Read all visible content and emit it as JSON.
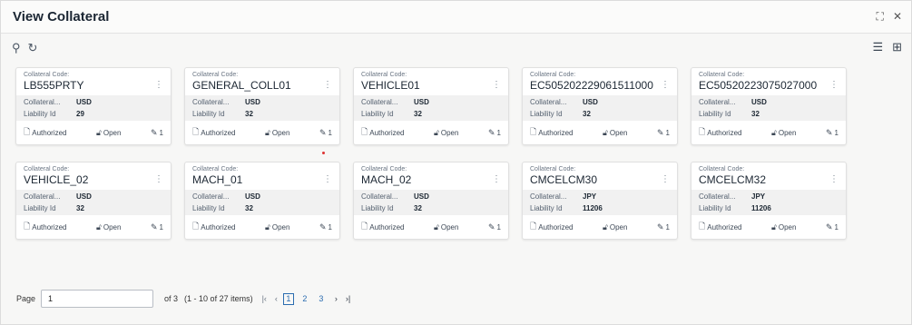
{
  "window": {
    "title": "View Collateral",
    "expand_icon": "⛶",
    "close_icon": "✕"
  },
  "toolbar": {
    "search_icon": "⚲",
    "refresh_icon": "↻",
    "list_view_icon": "☰",
    "grid_view_icon": "⊞"
  },
  "labels": {
    "code_label": "Collateral Code:",
    "collateral_label": "Collateral...",
    "liability_label": "Liability Id",
    "authorized": "Authorized",
    "open": "Open",
    "kebab": "⋮"
  },
  "cards": [
    {
      "code": "LB555PRTY",
      "currency": "USD",
      "liability_id": "29",
      "count": "1"
    },
    {
      "code": "GENERAL_COLL01",
      "currency": "USD",
      "liability_id": "32",
      "count": "1"
    },
    {
      "code": "VEHICLE01",
      "currency": "USD",
      "liability_id": "32",
      "count": "1"
    },
    {
      "code": "EC505202229061511000",
      "currency": "USD",
      "liability_id": "32",
      "count": "1"
    },
    {
      "code": "EC50520223075027000",
      "currency": "USD",
      "liability_id": "32",
      "count": "1"
    },
    {
      "code": "VEHICLE_02",
      "currency": "USD",
      "liability_id": "32",
      "count": "1"
    },
    {
      "code": "MACH_01",
      "currency": "USD",
      "liability_id": "32",
      "count": "1"
    },
    {
      "code": "MACH_02",
      "currency": "USD",
      "liability_id": "32",
      "count": "1"
    },
    {
      "code": "CMCELCM30",
      "currency": "JPY",
      "liability_id": "11206",
      "count": "1"
    },
    {
      "code": "CMCELCM32",
      "currency": "JPY",
      "liability_id": "11206",
      "count": "1"
    }
  ],
  "pagination": {
    "page_label": "Page",
    "page_value": "1",
    "of_text": "of 3",
    "range_text": "(1 - 10 of 27 items)",
    "first": "|‹",
    "prev": "‹",
    "pages": [
      "1",
      "2",
      "3"
    ],
    "next": "›",
    "last": "›|"
  }
}
